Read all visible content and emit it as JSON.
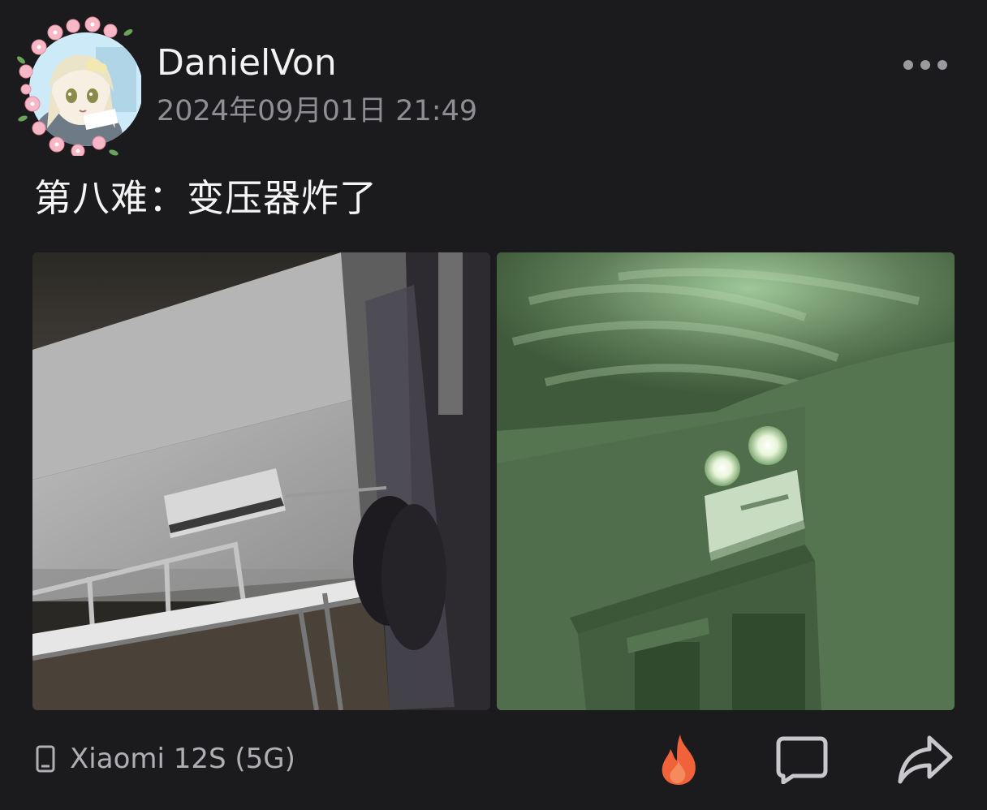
{
  "post": {
    "author": {
      "name": "DanielVon",
      "avatar_icon": "anime-avatar-with-flower-frame"
    },
    "timestamp": "2024年09月01日 21:49",
    "text": "第八难：变压器炸了",
    "images": [
      {
        "icon": "dorm-room-air-conditioner-photo"
      },
      {
        "icon": "emergency-light-green-photo"
      }
    ],
    "device": {
      "icon": "phone-icon",
      "label": "Xiaomi 12S (5G)"
    },
    "actions": {
      "like_icon": "flame-icon",
      "comment_icon": "comment-icon",
      "share_icon": "share-icon"
    }
  },
  "colors": {
    "background": "#1b1b1d",
    "text_primary": "#f2f2f2",
    "text_secondary": "#8e8e93",
    "flame": "#f0623a"
  }
}
